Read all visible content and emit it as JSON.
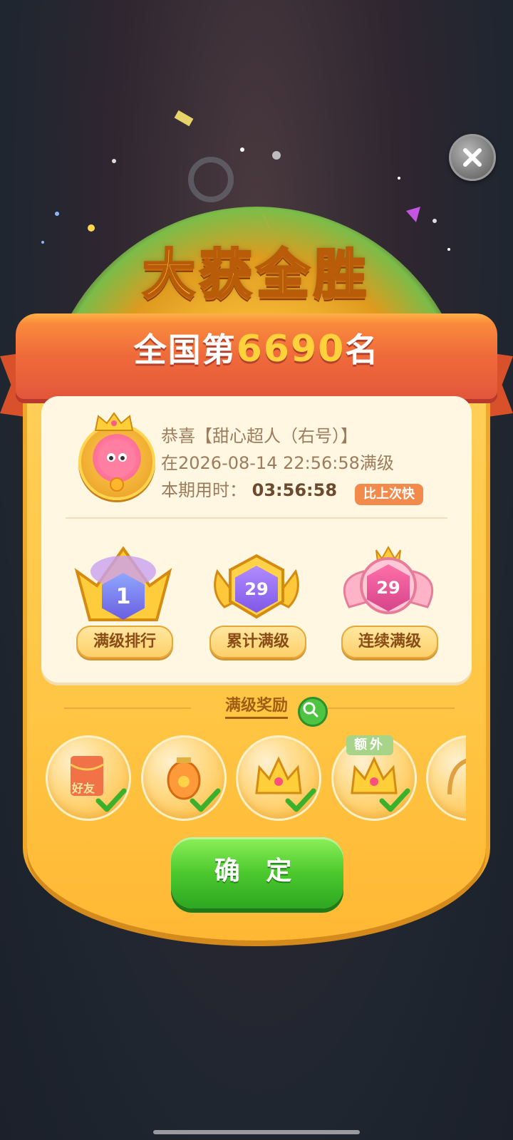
{
  "dialog": {
    "title": "大获全胜",
    "rank_prefix": "全国第",
    "rank_number": "6690",
    "rank_suffix": "名"
  },
  "user_info": {
    "congrats_line": "恭喜【甜心超人（右号）】",
    "level_line": "在2026-08-14 22:56:58满级",
    "time_label": "本期用时：",
    "time_value": "03:56:58",
    "faster_badge": "比上次快"
  },
  "badges": [
    {
      "label": "满级排行",
      "value": "1"
    },
    {
      "label": "累计满级",
      "value": "29"
    },
    {
      "label": "连续满级",
      "value": "29"
    }
  ],
  "rewards_section": {
    "title": "满级奖励",
    "extra_tag": "额外",
    "items": [
      {
        "icon": "red-envelope-icon",
        "text": "好友",
        "claimed": true
      },
      {
        "icon": "lantern-icon",
        "claimed": true
      },
      {
        "icon": "crown-icon",
        "claimed": true
      },
      {
        "icon": "crown-icon",
        "claimed": true
      },
      {
        "icon": "partial-item-icon",
        "claimed": false
      }
    ]
  },
  "confirm_button": "确 定",
  "colors": {
    "ribbon": "#ef6a3b",
    "panel": "#ffc543",
    "confirm": "#4cc92d",
    "title": "#ffd23b"
  }
}
